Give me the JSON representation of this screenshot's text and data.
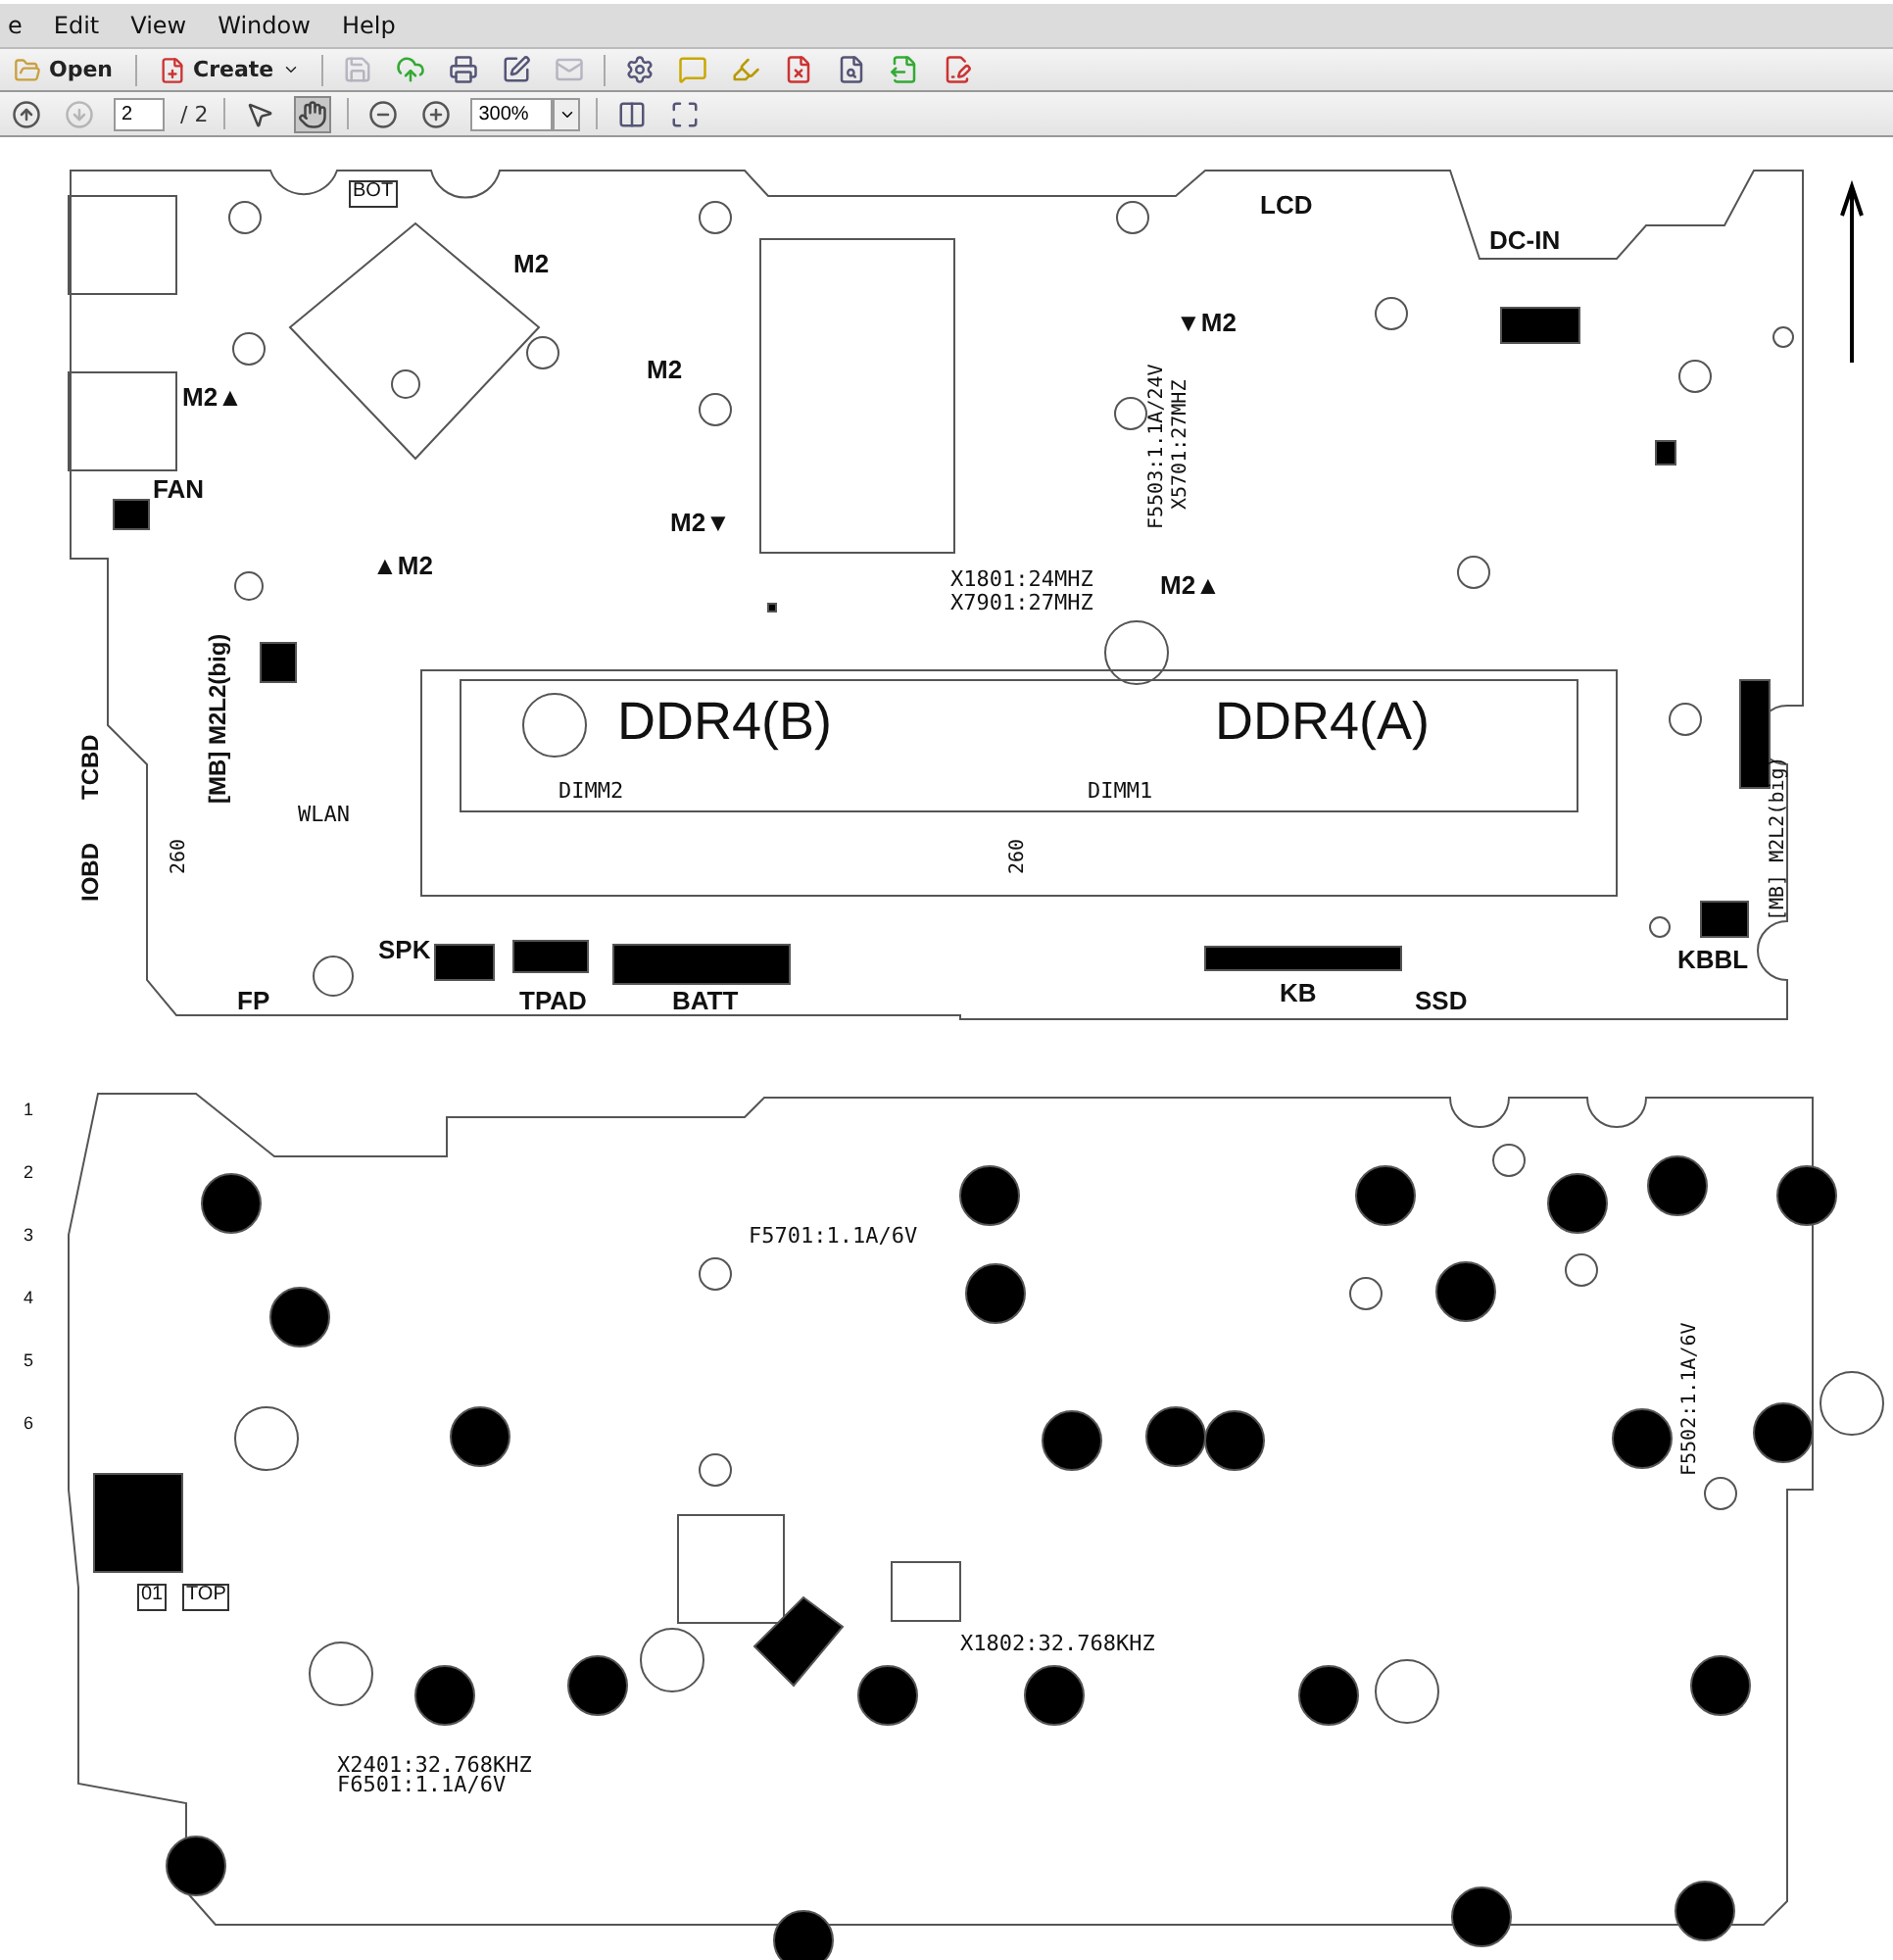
{
  "menu": [
    {
      "label": "e"
    },
    {
      "label": "Edit"
    },
    {
      "label": "View"
    },
    {
      "label": "Window"
    },
    {
      "label": "Help"
    }
  ],
  "toolbar": {
    "open": "Open",
    "create": "Create",
    "icons": [
      {
        "kind": "save",
        "disabled": true
      },
      {
        "kind": "upload",
        "disabled": false
      },
      {
        "kind": "print",
        "disabled": false
      },
      {
        "kind": "edit",
        "disabled": false
      },
      {
        "kind": "mail",
        "disabled": true
      },
      {
        "kind": "settings",
        "disabled": false
      },
      {
        "kind": "comment",
        "disabled": false
      },
      {
        "kind": "highlight",
        "disabled": false
      },
      {
        "kind": "delete-file",
        "disabled": false
      },
      {
        "kind": "search-file",
        "disabled": false
      },
      {
        "kind": "export",
        "disabled": false
      },
      {
        "kind": "sign",
        "disabled": false
      }
    ]
  },
  "navigation": {
    "buttons": [
      {
        "kind": "up",
        "disabled": false
      },
      {
        "kind": "down",
        "disabled": true
      }
    ],
    "page": "2",
    "total": "/ 2",
    "tools": [
      {
        "kind": "select",
        "selected": false
      },
      {
        "kind": "hand",
        "selected": true
      }
    ],
    "zoom": "300%"
  },
  "boards": [
    {
      "labels": [
        {
          "text": "BOT",
          "kind": "boxed"
        },
        {
          "text": "LCD",
          "kind": "bold"
        },
        {
          "text": "DC-IN",
          "kind": "bold"
        },
        {
          "text": "M2",
          "kind": "bold"
        },
        {
          "text": "▼M2",
          "kind": "bold"
        },
        {
          "text": "M2",
          "kind": "bold"
        },
        {
          "text": "M2▲",
          "kind": "bold"
        },
        {
          "text": "FAN",
          "kind": "bold"
        },
        {
          "text": "M2▼",
          "kind": "bold"
        },
        {
          "text": "X5701:27MHZ",
          "kind": "rotated-serif"
        },
        {
          "text": "F5503:1.1A/24V",
          "kind": "rotated-serif"
        },
        {
          "text": "▲M2",
          "kind": "bold"
        },
        {
          "text": "X1801:24MHZ",
          "kind": "serif"
        },
        {
          "text": "M2▲",
          "kind": "bold"
        },
        {
          "text": "X7901:27MHZ",
          "kind": "serif"
        },
        {
          "text": "DDR4(B)",
          "kind": "big"
        },
        {
          "text": "DDR4(A)",
          "kind": "big"
        },
        {
          "text": "DIMM2",
          "kind": "serif"
        },
        {
          "text": "DIMM1",
          "kind": "serif"
        },
        {
          "text": "TCBD",
          "kind": "rotated-bold"
        },
        {
          "text": "[MB] M2L2(big)",
          "kind": "rotated-bold"
        },
        {
          "text": "WLAN",
          "kind": "serif"
        },
        {
          "text": "260",
          "kind": "rotated-serif"
        },
        {
          "text": "260",
          "kind": "rotated-serif"
        },
        {
          "text": "IOBD",
          "kind": "rotated-bold"
        },
        {
          "text": "[MB] M2L2(big)",
          "kind": "rotated-serif"
        },
        {
          "text": "SPK",
          "kind": "bold"
        },
        {
          "text": "KBBL",
          "kind": "bold"
        },
        {
          "text": "FP",
          "kind": "bold"
        },
        {
          "text": "TPAD",
          "kind": "bold"
        },
        {
          "text": "BATT",
          "kind": "bold"
        },
        {
          "text": "KB",
          "kind": "bold"
        },
        {
          "text": "SSD",
          "kind": "bold"
        }
      ]
    },
    {
      "labels": [
        {
          "text": "F5701:1.1A/6V",
          "kind": "serif"
        },
        {
          "text": "F5502:1.1A/6V",
          "kind": "rotated-serif"
        },
        {
          "text": "X1802:32.768KHZ",
          "kind": "serif"
        },
        {
          "text": "X2401:32.768KHZ",
          "kind": "serif"
        },
        {
          "text": "F6501:1.1A/6V",
          "kind": "serif"
        },
        {
          "text": "01",
          "kind": "boxed"
        },
        {
          "text": "TOP",
          "kind": "boxed"
        },
        {
          "text": "1",
          "kind": "tiny"
        },
        {
          "text": "2",
          "kind": "tiny"
        },
        {
          "text": "3",
          "kind": "tiny"
        },
        {
          "text": "4",
          "kind": "tiny"
        },
        {
          "text": "5",
          "kind": "tiny"
        },
        {
          "text": "6",
          "kind": "tiny"
        }
      ]
    }
  ]
}
